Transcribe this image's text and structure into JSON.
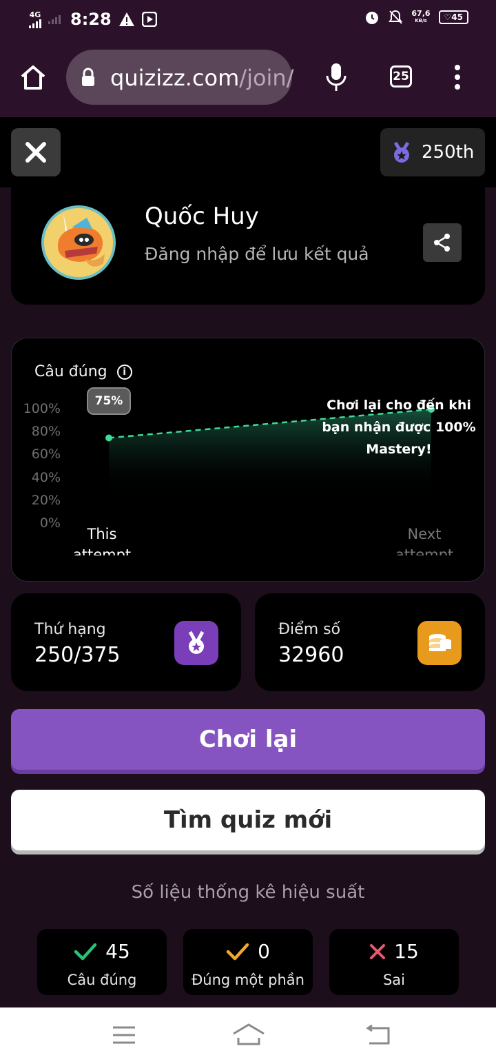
{
  "status_bar": {
    "network": "4G",
    "time": "8:28",
    "net_speed_value": "67,6",
    "net_speed_unit": "KB/s",
    "battery": "45"
  },
  "browser": {
    "url_host": "quizizz.com",
    "url_path": "/join/",
    "tab_count": "25"
  },
  "header": {
    "rank_label": "250th"
  },
  "profile": {
    "name": "Quốc Huy",
    "subtitle": "Đăng nhập để lưu kết quả"
  },
  "chart_data": {
    "type": "line",
    "title": "Câu đúng",
    "categories": [
      "This attempt",
      "Next attempt"
    ],
    "series": [
      {
        "values": [
          75,
          100
        ]
      }
    ],
    "ylim": [
      0,
      100
    ],
    "yticks": [
      "100%",
      "80%",
      "60%",
      "40%",
      "20%",
      "0%"
    ],
    "data_label": "75%",
    "annotation": "Chơi lại cho đến khi bạn nhận được 100% Mastery!",
    "grid": false
  },
  "stats": {
    "rank": {
      "label": "Thứ hạng",
      "value": "250/375"
    },
    "score": {
      "label": "Điểm số",
      "value": "32960"
    }
  },
  "buttons": {
    "play_again": "Chơi lại",
    "find_quiz": "Tìm quiz mới"
  },
  "performance": {
    "heading": "Số liệu thống kê hiệu suất",
    "correct": {
      "count": "45",
      "label": "Câu đúng"
    },
    "partial": {
      "count": "0",
      "label": "Đúng một phần"
    },
    "wrong": {
      "count": "15",
      "label": "Sai"
    }
  },
  "colors": {
    "accent_purple": "#8554c0",
    "chart_line": "#3ddc97",
    "correct": "#2bc27a",
    "partial": "#f0a830",
    "wrong": "#ef5470",
    "coin": "#f0a020"
  }
}
